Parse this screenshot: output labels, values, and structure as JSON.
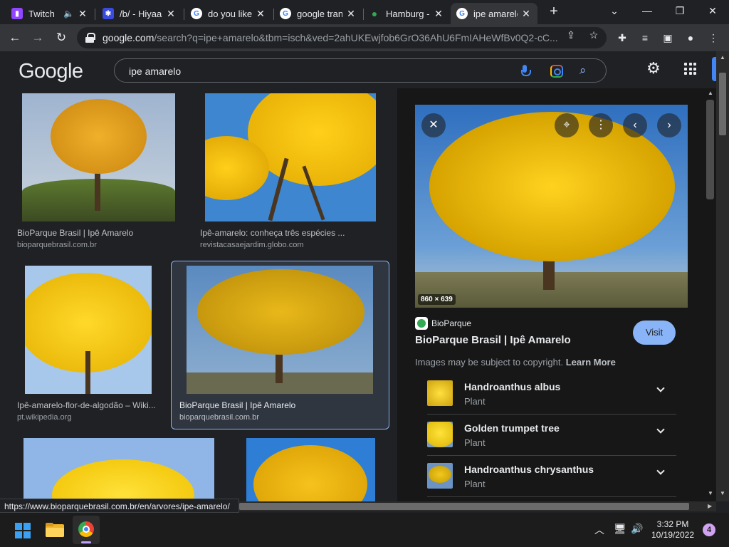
{
  "tabs": [
    {
      "title": "Twitch",
      "icon": "twitch-icon",
      "color": "#9146ff"
    },
    {
      "title": "/b/ - Hiyaa",
      "icon": "site-icon",
      "color": "#3a4be0"
    },
    {
      "title": "do you like",
      "icon": "google-icon",
      "color": "#4285f4"
    },
    {
      "title": "google tran",
      "icon": "google-icon",
      "color": "#4285f4"
    },
    {
      "title": "Hamburg -",
      "icon": "maps-pin-icon",
      "color": "#34a853"
    },
    {
      "title": "ipe amarelo",
      "icon": "google-icon",
      "color": "#4285f4"
    }
  ],
  "toolbar": {
    "url_host": "google.com",
    "url_rest": "/search?q=ipe+amarelo&tbm=isch&ved=2ahUKEwjfob6GrO36AhU6FmIAHeWfBv0Q2-cC..."
  },
  "google": {
    "logo": "Google",
    "query": "ipe amarelo"
  },
  "results": [
    {
      "title": "BioParque Brasil | Ipê Amarelo",
      "source": "bioparquebrasil.com.br"
    },
    {
      "title": "Ipê-amarelo: conheça três espécies ...",
      "source": "revistacasaejardim.globo.com"
    },
    {
      "title": "Ipê-amarelo-flor-de-algodão – Wiki...",
      "source": "pt.wikipedia.org"
    },
    {
      "title": "BioParque Brasil | Ipê Amarelo",
      "source": "bioparquebrasil.com.br"
    }
  ],
  "panel": {
    "dimensions": "860 × 639",
    "source_name": "BioParque",
    "title": "BioParque Brasil | Ipê Amarelo",
    "visit_label": "Visit",
    "copyright_text": "Images may be subject to copyright.",
    "learn_more": "Learn More",
    "related": [
      {
        "name": "Handroanthus albus",
        "kind": "Plant"
      },
      {
        "name": "Golden trumpet tree",
        "kind": "Plant"
      },
      {
        "name": "Handroanthus chrysanthus",
        "kind": "Plant"
      }
    ]
  },
  "status_url": "https://www.bioparquebrasil.com.br/en/arvores/ipe-amarelo/",
  "taskbar": {
    "time": "3:32 PM",
    "date": "10/19/2022",
    "notifications": "4"
  },
  "colors": {
    "accent": "#8ab4f8",
    "background": "#202124",
    "panel": "#171717"
  }
}
